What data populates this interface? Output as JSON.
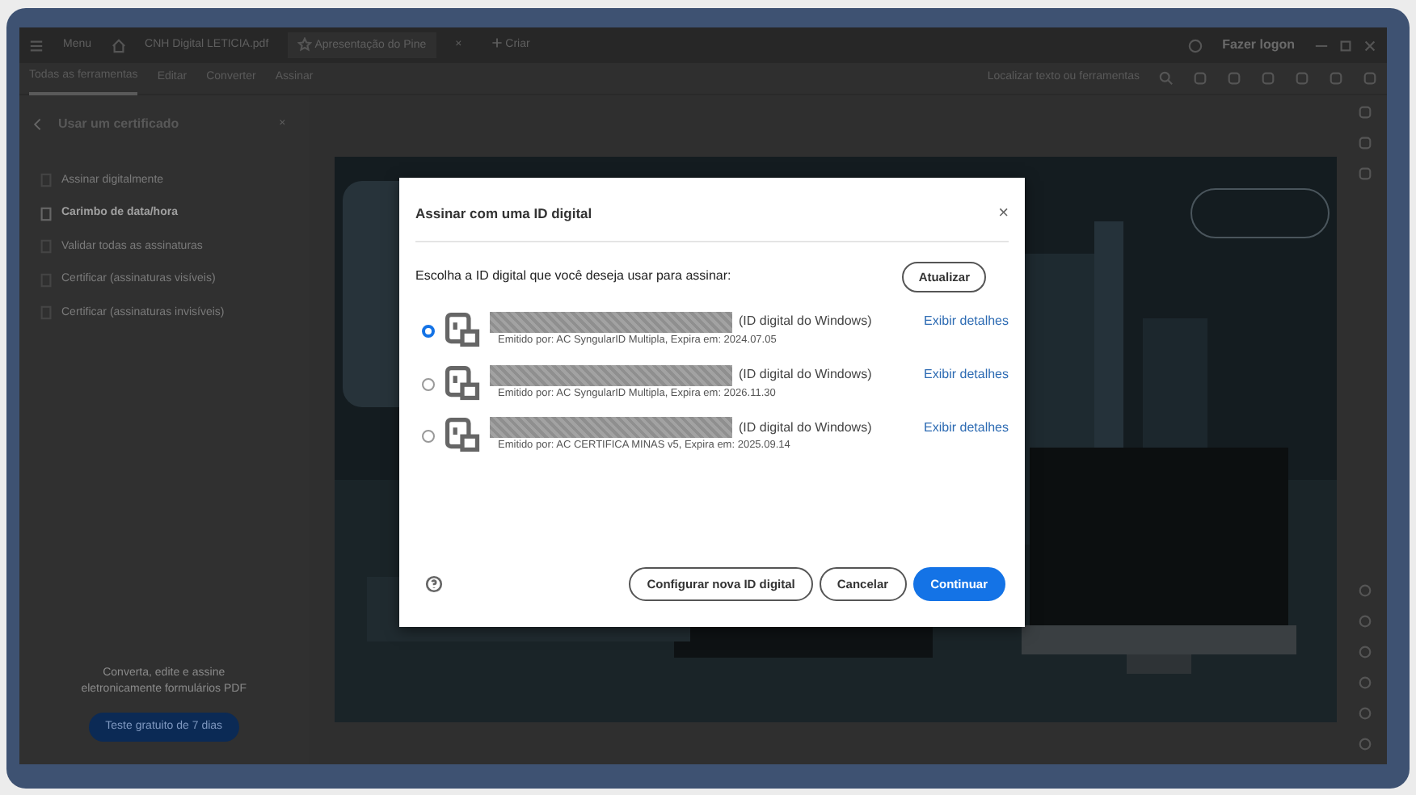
{
  "tabs": [
    {
      "label": "Menu",
      "kind": "menu"
    },
    {
      "label": "CNH Digital LETICIA.pdf",
      "kind": "file",
      "selected": false
    },
    {
      "label": "Apresentação do Pine",
      "kind": "file",
      "selected": true,
      "close": "×"
    },
    {
      "label": "Criar",
      "kind": "new"
    }
  ],
  "account": {
    "label": "Fazer logon"
  },
  "toolbar_tabs": [
    {
      "label": "Todas as ferramentas",
      "selected": true
    },
    {
      "label": "Editar",
      "selected": false
    },
    {
      "label": "Converter",
      "selected": false
    },
    {
      "label": "Assinar",
      "selected": false
    }
  ],
  "search": {
    "placeholder": "Localizar texto ou ferramentas"
  },
  "panel": {
    "title": "Usar um certificado",
    "items": [
      {
        "label": "Assinar digitalmente",
        "disabled": true
      },
      {
        "label": "Carimbo de data/hora",
        "disabled": false
      },
      {
        "label": "Validar todas as assinaturas",
        "disabled": true
      },
      {
        "label": "Certificar (assinaturas visíveis)",
        "disabled": true
      },
      {
        "label": "Certificar (assinaturas invisíveis)",
        "disabled": true
      }
    ],
    "promo": "Converta, edite e assine eletronicamente formulários PDF",
    "trial_button": "Teste gratuito de 7 dias"
  },
  "dialog": {
    "title": "Assinar com uma ID digital",
    "close": "×",
    "prompt": "Escolha a ID digital que você deseja usar para assinar:",
    "refresh_button": "Atualizar",
    "ids": [
      {
        "selected": true,
        "type": "(ID digital do Windows)",
        "link": "Exibir detalhes",
        "issuer": "Emitido por: AC SyngularID Multipla, Expira em: 2024.07.05"
      },
      {
        "selected": false,
        "type": "(ID digital do Windows)",
        "link": "Exibir detalhes",
        "issuer": "Emitido por: AC SyngularID Multipla, Expira em: 2026.11.30"
      },
      {
        "selected": false,
        "type": "(ID digital do Windows)",
        "link": "Exibir detalhes",
        "issuer": "Emitido por: AC CERTIFICA MINAS v5, Expira em: 2025.09.14"
      }
    ],
    "buttons": [
      {
        "label": "Configurar nova ID digital",
        "kind": "secondary"
      },
      {
        "label": "Cancelar",
        "kind": "secondary"
      },
      {
        "label": "Continuar",
        "kind": "primary"
      }
    ]
  }
}
